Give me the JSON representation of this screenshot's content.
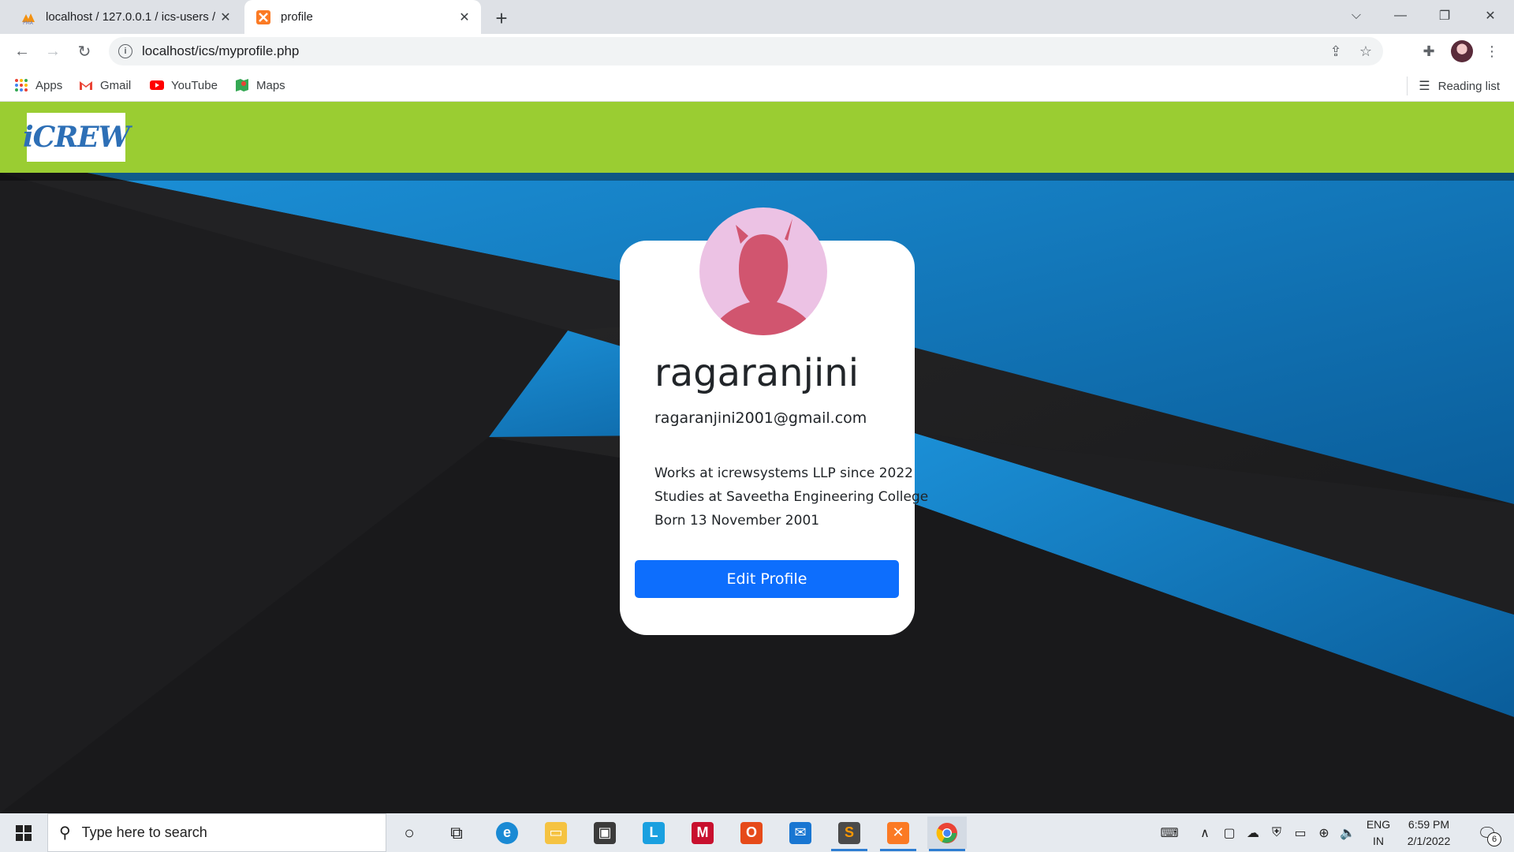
{
  "browser": {
    "tabs": [
      {
        "title": "localhost / 127.0.0.1 / ics-users /",
        "favicon": "phpmyadmin-icon"
      },
      {
        "title": "profile",
        "favicon": "xampp-icon",
        "active": true
      }
    ],
    "url": "localhost/ics/myprofile.php",
    "bookmarks": [
      {
        "label": "Apps",
        "icon": "apps-grid-icon"
      },
      {
        "label": "Gmail",
        "icon": "gmail-icon"
      },
      {
        "label": "YouTube",
        "icon": "youtube-icon"
      },
      {
        "label": "Maps",
        "icon": "maps-icon"
      }
    ],
    "reading_list": "Reading list"
  },
  "site": {
    "logo_text": "iCREW",
    "header_color": "#9acd32"
  },
  "profile": {
    "username": "ragaranjini",
    "email": "ragaranjini2001@gmail.com",
    "about": [
      "Works at icrewsystems LLP since 2022",
      "Studies at Saveetha Engineering College",
      "Born 13 November 2001"
    ],
    "edit_button": "Edit Profile",
    "button_color": "#0d6efd"
  },
  "taskbar": {
    "search_placeholder": "Type here to search",
    "language": [
      "ENG",
      "IN"
    ],
    "time": "6:59 PM",
    "date": "2/1/2022",
    "notification_count": "6"
  }
}
